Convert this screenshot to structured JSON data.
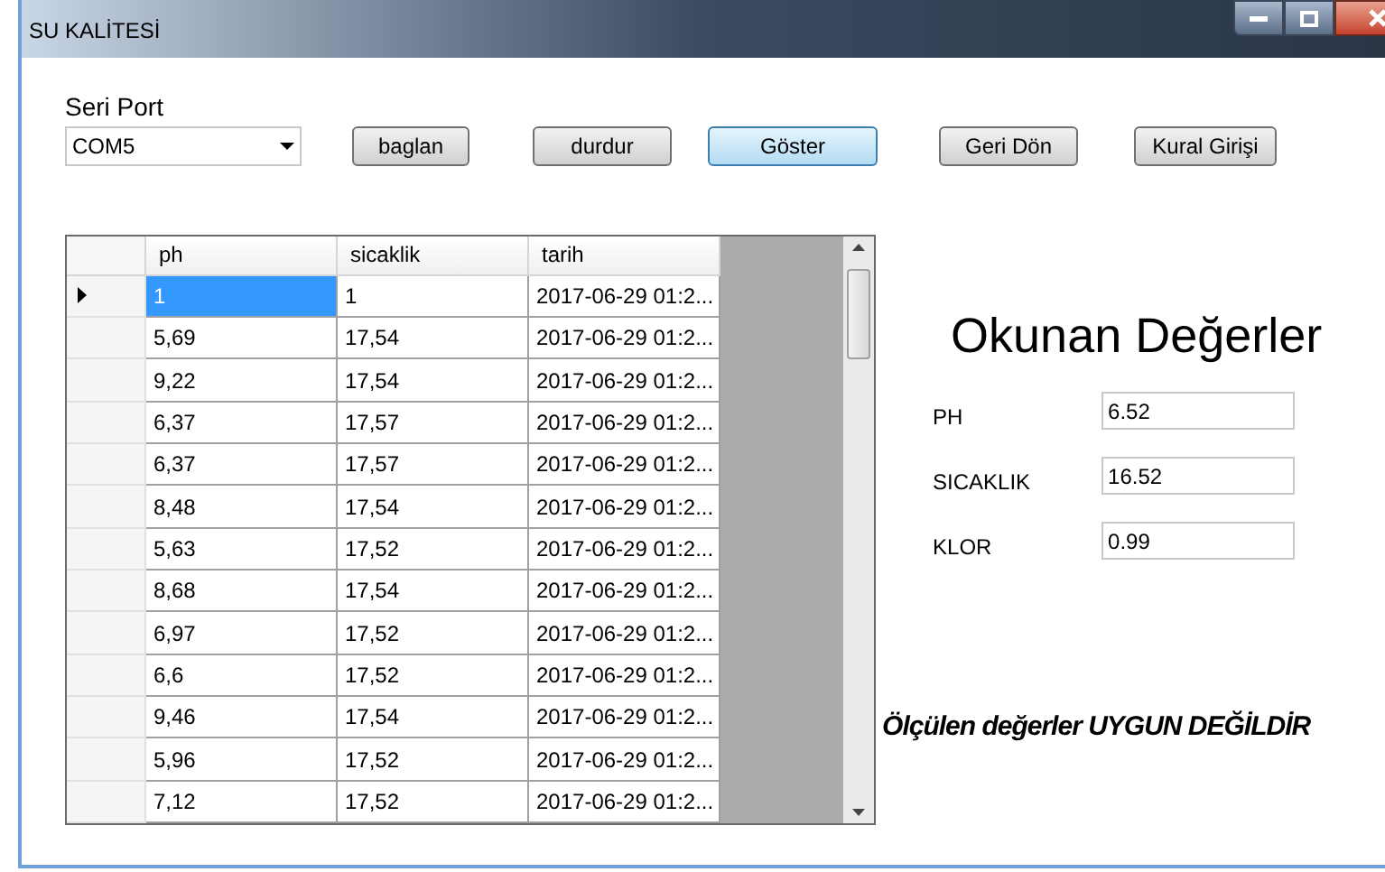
{
  "window": {
    "title": "SU KALİTESİ"
  },
  "port": {
    "label": "Seri Port",
    "value": "COM5"
  },
  "buttons": [
    {
      "label": "baglan",
      "focused": false
    },
    {
      "label": "durdur",
      "focused": false
    },
    {
      "label": "Göster",
      "focused": true
    },
    {
      "label": "Geri Dön",
      "focused": false
    },
    {
      "label": "Kural Girişi",
      "focused": false
    }
  ],
  "table": {
    "columns": [
      "ph",
      "sicaklik",
      "tarih"
    ],
    "rows": [
      {
        "selected": true,
        "cells": [
          "1",
          "1",
          "2017-06-29 01:2..."
        ]
      },
      {
        "selected": false,
        "cells": [
          "5,69",
          "17,54",
          "2017-06-29 01:2..."
        ]
      },
      {
        "selected": false,
        "cells": [
          "9,22",
          "17,54",
          "2017-06-29 01:2..."
        ]
      },
      {
        "selected": false,
        "cells": [
          "6,37",
          "17,57",
          "2017-06-29 01:2..."
        ]
      },
      {
        "selected": false,
        "cells": [
          "6,37",
          "17,57",
          "2017-06-29 01:2..."
        ]
      },
      {
        "selected": false,
        "cells": [
          "8,48",
          "17,54",
          "2017-06-29 01:2..."
        ]
      },
      {
        "selected": false,
        "cells": [
          "5,63",
          "17,52",
          "2017-06-29 01:2..."
        ]
      },
      {
        "selected": false,
        "cells": [
          "8,68",
          "17,54",
          "2017-06-29 01:2..."
        ]
      },
      {
        "selected": false,
        "cells": [
          "6,97",
          "17,52",
          "2017-06-29 01:2..."
        ]
      },
      {
        "selected": false,
        "cells": [
          "6,6",
          "17,52",
          "2017-06-29 01:2..."
        ]
      },
      {
        "selected": false,
        "cells": [
          "9,46",
          "17,54",
          "2017-06-29 01:2..."
        ]
      },
      {
        "selected": false,
        "cells": [
          "5,96",
          "17,52",
          "2017-06-29 01:2..."
        ]
      },
      {
        "selected": false,
        "cells": [
          "7,12",
          "17,52",
          "2017-06-29 01:2..."
        ]
      }
    ]
  },
  "readings": {
    "title": "Okunan Değerler",
    "fields": [
      {
        "label": "PH",
        "value": "6.52"
      },
      {
        "label": "SICAKLIK",
        "value": "16.52"
      },
      {
        "label": "KLOR",
        "value": "0.99"
      }
    ]
  },
  "verdict": "Ölçülen değerler UYGUN DEĞİLDİR"
}
